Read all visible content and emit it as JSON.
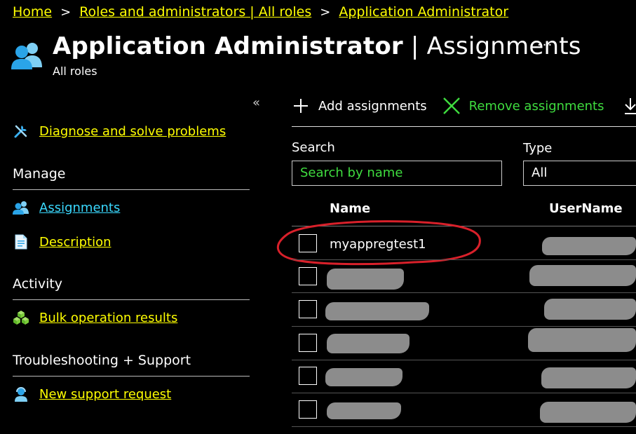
{
  "breadcrumb": {
    "items": [
      "Home",
      "Roles and administrators | All roles",
      "Application Administrator"
    ],
    "separator": ">"
  },
  "header": {
    "title_main": "Application Administrator",
    "title_sep": " | ",
    "title_rest": "Assignments",
    "subtitle": "All roles",
    "more": "···",
    "icon": "users-icon"
  },
  "sidebar": {
    "collapse": "«",
    "diagnose": "Diagnose and solve problems",
    "manage_heading": "Manage",
    "assignments": "Assignments",
    "description": "Description",
    "activity_heading": "Activity",
    "bulk": "Bulk operation results",
    "troubleshooting_heading": "Troubleshooting + Support",
    "support": "New support request"
  },
  "toolbar": {
    "add_label": "Add assignments",
    "remove_label": "Remove assignments",
    "download_icon": "download-icon"
  },
  "filters": {
    "search_label": "Search",
    "search_placeholder": "Search by name",
    "type_label": "Type",
    "type_value": "All"
  },
  "table": {
    "columns": [
      "Name",
      "UserName"
    ],
    "rows": [
      {
        "name": "myappregtest1"
      },
      {
        "name": ""
      },
      {
        "name": ""
      },
      {
        "name": ""
      },
      {
        "name": ""
      },
      {
        "name": ""
      }
    ]
  },
  "colors": {
    "background": "#000000",
    "link": "#ffff00",
    "active_link": "#3ad9ff",
    "remove": "#3fdc3f",
    "highlight": "#d8202a"
  }
}
